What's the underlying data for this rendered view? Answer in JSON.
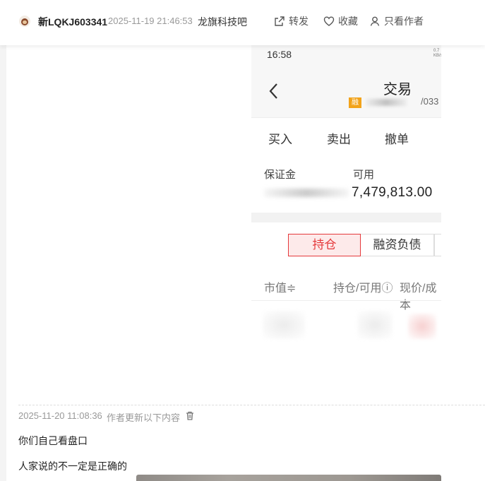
{
  "header": {
    "username": "新LQKJ603341",
    "post_time": "2025-11-19 21:46:53",
    "forum_name": "龙旗科技吧",
    "actions": [
      {
        "label": "转发",
        "icon": "share-icon"
      },
      {
        "label": "收藏",
        "icon": "heart-icon"
      },
      {
        "label": "只看作者",
        "icon": "user-icon"
      }
    ]
  },
  "screenshot": {
    "status_time": "16:58",
    "status_right": "0.7\nKB/s",
    "title": "交易",
    "badge": "融",
    "account_tail": "/033",
    "trade_tabs": [
      "买入",
      "卖出",
      "撤单"
    ],
    "margin_label": "保证金",
    "available_label": "可用",
    "available_value": "7,479,813.00",
    "position_tab": "持仓",
    "debt_tab": "融资负债",
    "column_headers": [
      "市值≑",
      "持仓/可用ⓘ",
      "现价/成本"
    ]
  },
  "update": {
    "time": "2025-11-20 11:08:36",
    "note": "作者更新以下内容",
    "lines": [
      "你们自己看盘口",
      "人家说的不一定是正确的"
    ]
  }
}
